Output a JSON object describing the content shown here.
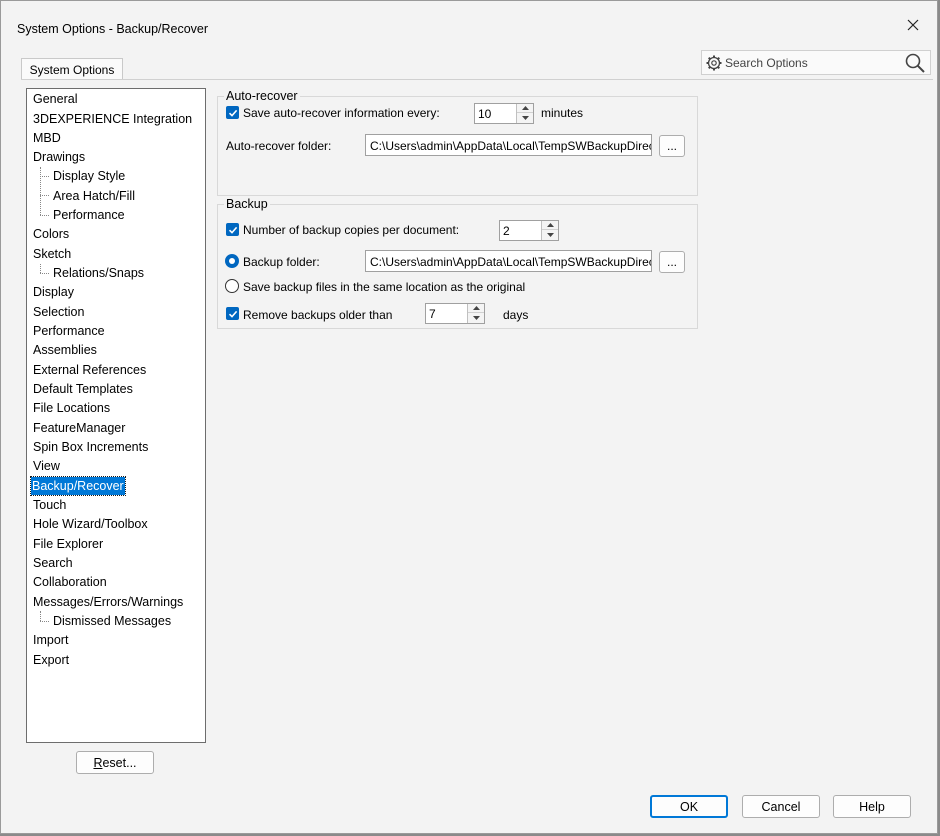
{
  "window": {
    "title": "System Options - Backup/Recover"
  },
  "tabs": [
    {
      "label": "System Options"
    }
  ],
  "search": {
    "placeholder": "Search Options"
  },
  "tree": {
    "items": [
      {
        "label": "General"
      },
      {
        "label": "3DEXPERIENCE Integration"
      },
      {
        "label": "MBD"
      },
      {
        "label": "Drawings"
      },
      {
        "label": "Display Style"
      },
      {
        "label": "Area Hatch/Fill"
      },
      {
        "label": "Performance"
      },
      {
        "label": "Colors"
      },
      {
        "label": "Sketch"
      },
      {
        "label": "Relations/Snaps"
      },
      {
        "label": "Display"
      },
      {
        "label": "Selection"
      },
      {
        "label": "Performance"
      },
      {
        "label": "Assemblies"
      },
      {
        "label": "External References"
      },
      {
        "label": "Default Templates"
      },
      {
        "label": "File Locations"
      },
      {
        "label": "FeatureManager"
      },
      {
        "label": "Spin Box Increments"
      },
      {
        "label": "View"
      },
      {
        "label": "Backup/Recover"
      },
      {
        "label": "Touch"
      },
      {
        "label": "Hole Wizard/Toolbox"
      },
      {
        "label": "File Explorer"
      },
      {
        "label": "Search"
      },
      {
        "label": "Collaboration"
      },
      {
        "label": "Messages/Errors/Warnings"
      },
      {
        "label": "Dismissed Messages"
      },
      {
        "label": "Import"
      },
      {
        "label": "Export"
      }
    ]
  },
  "reset_button": {
    "prefix": "R",
    "rest": "eset..."
  },
  "auto_recover": {
    "group_label": "Auto-recover",
    "save_label": "Save auto-recover information every:",
    "save_checked": true,
    "interval_value": "10",
    "interval_unit": "minutes",
    "folder_label": "Auto-recover folder:",
    "folder_value": "C:\\Users\\admin\\AppData\\Local\\TempSWBackupDirectory\\swxauto"
  },
  "backup": {
    "group_label": "Backup",
    "copies_label": "Number of backup copies per document:",
    "copies_checked": true,
    "copies_value": "2",
    "folder_option_label": "Backup folder:",
    "folder_option_selected": true,
    "folder_value": "C:\\Users\\admin\\AppData\\Local\\TempSWBackupDirectory\\swxbackup",
    "same_location_label": "Save backup files in the same location as the original",
    "same_location_selected": false,
    "remove_label": "Remove backups older than",
    "remove_checked": true,
    "remove_value": "7",
    "remove_unit": "days"
  },
  "browse_label": "...",
  "footer": {
    "ok": "OK",
    "cancel": "Cancel",
    "help": "Help"
  },
  "colors": {
    "selection": "#0078d7",
    "checkbox": "#0067c0"
  }
}
